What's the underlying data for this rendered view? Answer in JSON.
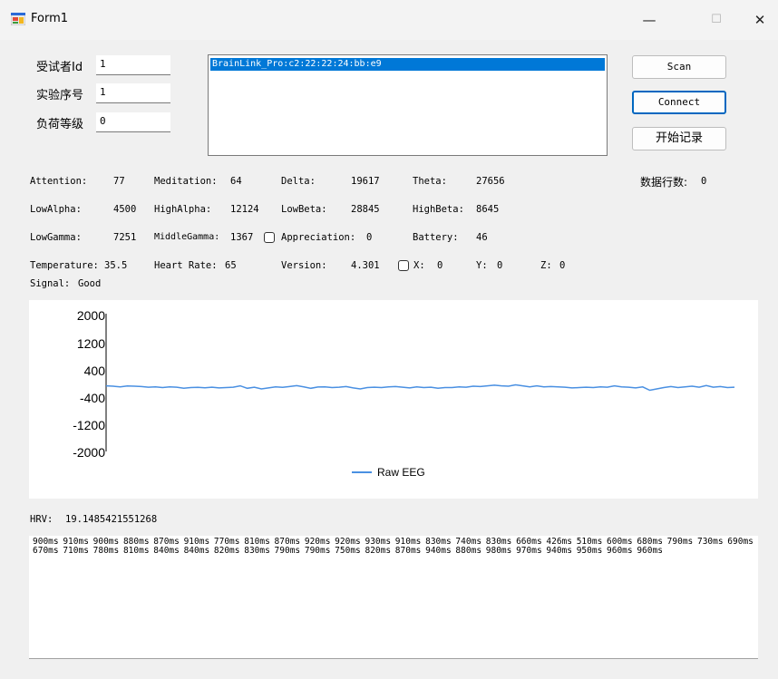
{
  "window": {
    "title": "Form1",
    "minimize": "—",
    "maximize": "☐",
    "close": "✕"
  },
  "form": {
    "subject_id_label": "受试者Id",
    "subject_id_value": "1",
    "trial_label": "实验序号",
    "trial_value": "1",
    "load_label": "负荷等级",
    "load_value": "0"
  },
  "devices": {
    "items": [
      "BrainLink_Pro:c2:22:22:24:bb:e9"
    ],
    "selected_index": 0
  },
  "buttons": {
    "scan": "Scan",
    "connect": "Connect",
    "record": "开始记录"
  },
  "row_count": {
    "label": "数据行数:",
    "value": "0"
  },
  "metrics": {
    "attention_label": "Attention:",
    "attention": "77",
    "meditation_label": "Meditation:",
    "meditation": "64",
    "delta_label": "Delta:",
    "delta": "19617",
    "theta_label": "Theta:",
    "theta": "27656",
    "lowalpha_label": "LowAlpha:",
    "lowalpha": "4500",
    "highalpha_label": "HighAlpha:",
    "highalpha": "12124",
    "lowbeta_label": "LowBeta:",
    "lowbeta": "28845",
    "highbeta_label": "HighBeta:",
    "highbeta": "8645",
    "lowgamma_label": "LowGamma:",
    "lowgamma": "7251",
    "middlegamma_label": "MiddleGamma:",
    "middlegamma": "1367",
    "appreciation_label": "Appreciation:",
    "appreciation": "0",
    "battery_label": "Battery:",
    "battery": "46",
    "temperature_label": "Temperature:",
    "temperature": "35.5",
    "heartrate_label": "Heart Rate:",
    "heartrate": "65",
    "version_label": "Version:",
    "version": "4.301",
    "x_label": "X:",
    "x": "0",
    "y_label": "Y:",
    "y": "0",
    "z_label": "Z:",
    "z": "0",
    "signal_label": "Signal:",
    "signal": "Good"
  },
  "hrv": {
    "label": "HRV:",
    "value": "19.1485421551268",
    "intervals": "900ms 910ms 900ms 880ms 870ms 910ms 770ms 810ms 870ms 920ms 920ms 930ms 910ms 830ms 740ms 830ms 660ms 426ms 510ms 600ms 680ms 790ms 730ms 690ms 670ms 710ms 780ms 810ms 840ms 840ms 820ms 830ms 790ms 790ms 750ms 820ms 870ms 940ms 880ms 980ms 970ms 940ms 950ms 960ms 960ms"
  },
  "chart_data": {
    "type": "line",
    "ylim": [
      -2000,
      2000
    ],
    "yticks": [
      "2000",
      "1200",
      "400",
      "-400",
      "-1200",
      "-2000"
    ],
    "series": [
      {
        "name": "Raw EEG",
        "color": "#4a90e2",
        "values": [
          10,
          0,
          -20,
          5,
          0,
          -10,
          -30,
          -20,
          -40,
          -20,
          -30,
          -60,
          -40,
          -35,
          -45,
          -30,
          -50,
          -40,
          -30,
          10,
          -60,
          -30,
          -80,
          -50,
          -20,
          -35,
          -10,
          15,
          -20,
          -60,
          -25,
          -20,
          -40,
          -30,
          -10,
          -50,
          -80,
          -40,
          -30,
          -40,
          -20,
          -10,
          -30,
          -50,
          -20,
          -40,
          -30,
          -60,
          -40,
          -40,
          -20,
          -30,
          0,
          -10,
          10,
          30,
          10,
          0,
          40,
          10,
          -20,
          10,
          -20,
          -10,
          -20,
          -30,
          -50,
          -40,
          -30,
          -40,
          -20,
          -30,
          10,
          -20,
          -30,
          -50,
          -20,
          -120,
          -80,
          -40,
          -10,
          -40,
          -20,
          0,
          -30,
          20,
          -30,
          -10,
          -40,
          -30
        ]
      }
    ]
  }
}
